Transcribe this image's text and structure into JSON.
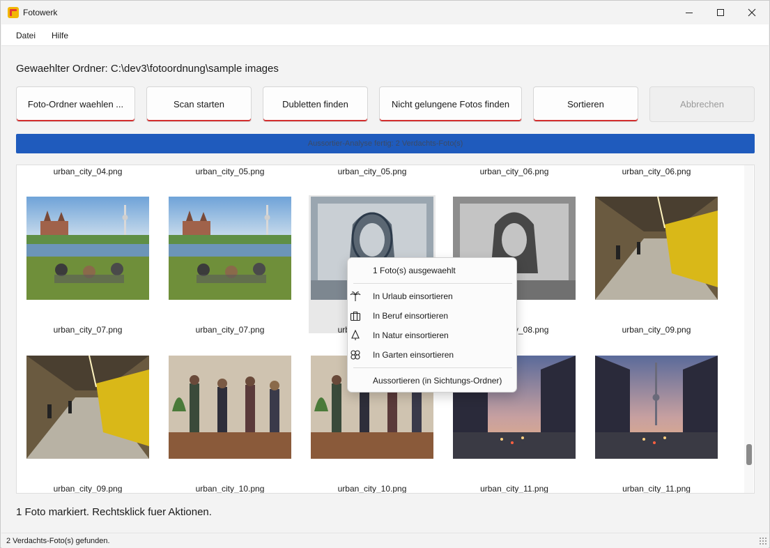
{
  "app": {
    "title": "Fotowerk"
  },
  "menu": [
    "Datei",
    "Hilfe"
  ],
  "folder": {
    "label": "Gewaehlter Ordner: C:\\dev3\\fotoordnung\\sample images"
  },
  "toolbar": {
    "choose_folder": "Foto-Ordner waehlen ...",
    "scan": "Scan starten",
    "duplicates": "Dubletten finden",
    "failed": "Nicht gelungene Fotos finden",
    "sort": "Sortieren",
    "cancel": "Abbrechen"
  },
  "progress": {
    "text": "Aussortier-Analyse fertig: 2 Verdachts-Foto(s)",
    "value": 1.0
  },
  "gallery": {
    "top_captions": [
      "urban_city_04.png",
      "urban_city_05.png",
      "urban_city_05.png",
      "urban_city_06.png",
      "urban_city_06.png"
    ],
    "row1_captions": [
      "urban_city_07.png",
      "urban_city_07.png",
      "urban_city_08.png",
      "urban_city_08.png",
      "urban_city_09.png"
    ],
    "row2_captions": [
      "urban_city_09.png",
      "urban_city_10.png",
      "urban_city_10.png",
      "urban_city_11.png",
      "urban_city_11.png"
    ]
  },
  "context_menu": {
    "header": "1 Foto(s) ausgewaehlt",
    "items": [
      {
        "label": "In Urlaub einsortieren",
        "icon": "palm-tree-icon"
      },
      {
        "label": "In Beruf einsortieren",
        "icon": "briefcase-icon"
      },
      {
        "label": "In Natur einsortieren",
        "icon": "tree-icon"
      },
      {
        "label": "In Garten einsortieren",
        "icon": "flower-icon"
      }
    ],
    "discard": "Aussortieren (in Sichtungs-Ordner)"
  },
  "status": {
    "main": "1 Foto markiert. Rechtsklick fuer Aktionen.",
    "bar": "2 Verdachts-Foto(s) gefunden."
  },
  "colors": {
    "accent": "#d32f2f",
    "progress": "#1f5bbd"
  }
}
